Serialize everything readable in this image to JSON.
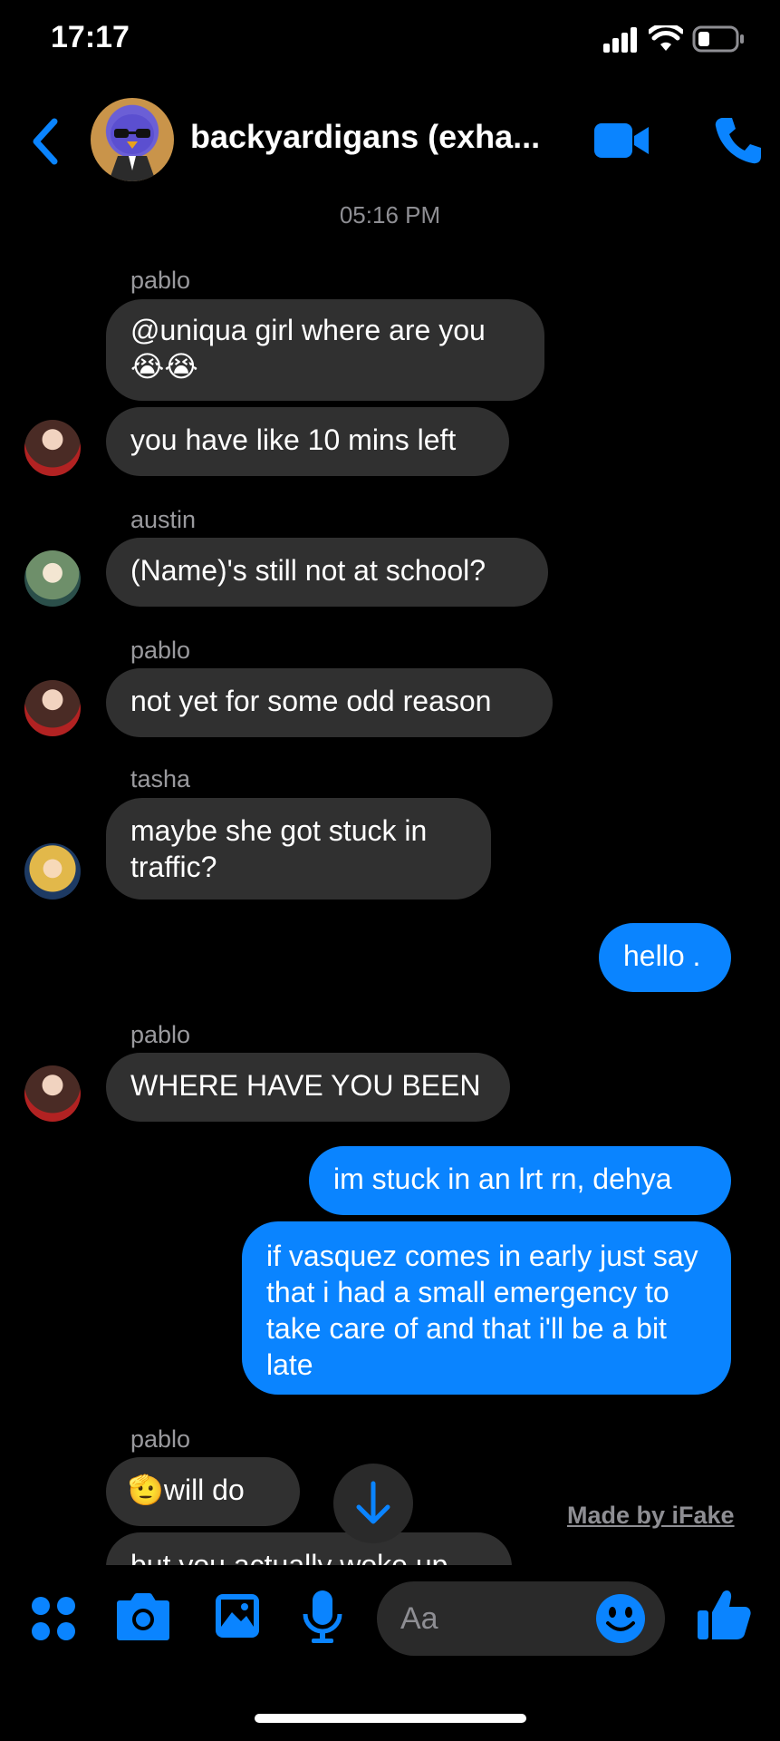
{
  "status": {
    "time": "17:17"
  },
  "header": {
    "title": "backyardigans (exha..."
  },
  "timestamp": "05:16 PM",
  "messages": {
    "pablo1_name": "pablo",
    "pablo1_a": "@uniqua girl where are you",
    "pablo1_a_emoji": "😭😭",
    "pablo1_b": "you have like 10 mins left",
    "austin_name": "austin",
    "austin_a": "(Name)'s still not at school?",
    "pablo2_name": "pablo",
    "pablo2_a": "not yet for some odd reason",
    "tasha_name": "tasha",
    "tasha_a": "maybe she got stuck in traffic?",
    "me_1": "hello .",
    "pablo3_name": "pablo",
    "pablo3_a": "WHERE HAVE YOU BEEN",
    "me_2": "im stuck in an lrt rn, dehya",
    "me_3": "if vasquez comes in early just say that i had a small emergency to take care of and that i'll be a bit late",
    "pablo4_name": "pablo",
    "pablo4_a_emoji": "🫡",
    "pablo4_a": "will do",
    "pablo4_b": "but you actually woke up"
  },
  "watermark": "Made by iFake",
  "composer": {
    "placeholder": "Aa"
  },
  "colors": {
    "accent": "#0a84ff",
    "incoming_bubble": "#303030",
    "background": "#000000"
  },
  "icons": [
    "chevron-left-icon",
    "video-camera-icon",
    "phone-icon",
    "apps-grid-icon",
    "camera-icon",
    "image-icon",
    "microphone-icon",
    "emoji-icon",
    "thumbs-up-icon",
    "arrow-down-icon",
    "signal-icon",
    "wifi-icon",
    "battery-icon"
  ]
}
